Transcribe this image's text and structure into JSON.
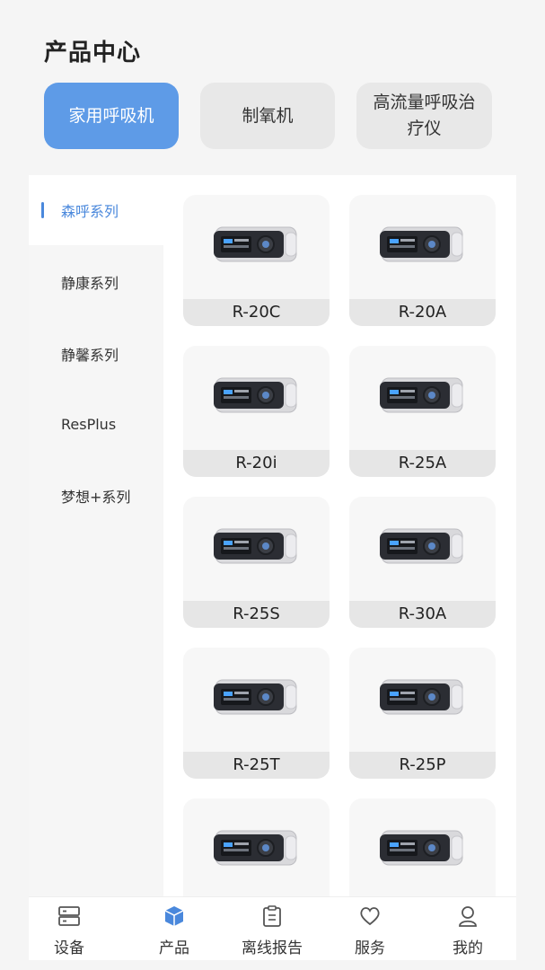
{
  "header": {
    "title": "产品中心"
  },
  "categories": [
    {
      "label": "家用呼吸机",
      "active": true
    },
    {
      "label": "制氧机",
      "active": false
    },
    {
      "label": "高流量呼吸治疗仪",
      "active": false
    }
  ],
  "series": [
    {
      "label": "森呼系列",
      "active": true
    },
    {
      "label": "静康系列",
      "active": false
    },
    {
      "label": "静馨系列",
      "active": false
    },
    {
      "label": "ResPlus",
      "active": false
    },
    {
      "label": "梦想+系列",
      "active": false
    }
  ],
  "products": [
    {
      "name": "R-20C"
    },
    {
      "name": "R-20A"
    },
    {
      "name": "R-20i"
    },
    {
      "name": "R-25A"
    },
    {
      "name": "R-25S"
    },
    {
      "name": "R-30A"
    },
    {
      "name": "R-25T"
    },
    {
      "name": "R-25P"
    },
    {
      "name": ""
    },
    {
      "name": ""
    }
  ],
  "bottom_nav": [
    {
      "label": "设备",
      "icon": "device-icon",
      "active": false
    },
    {
      "label": "产品",
      "icon": "cube-icon",
      "active": true
    },
    {
      "label": "离线报告",
      "icon": "clipboard-icon",
      "active": false
    },
    {
      "label": "服务",
      "icon": "heart-icon",
      "active": false
    },
    {
      "label": "我的",
      "icon": "profile-icon",
      "active": false
    }
  ],
  "colors": {
    "accent": "#4a88dc",
    "active_tab": "#5e9be7"
  }
}
